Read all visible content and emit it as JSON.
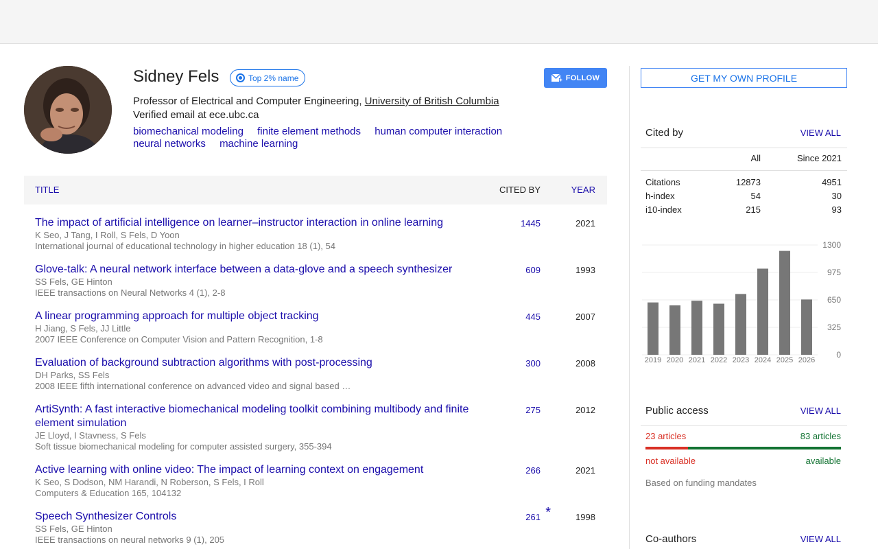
{
  "profile": {
    "name": "Sidney Fels",
    "badge": "Top 2% name",
    "follow": "FOLLOW",
    "title_prefix": "Professor of Electrical and Computer Engineering, ",
    "university": "University of British Columbia",
    "email": "Verified email at ece.ubc.ca",
    "interests": [
      "biomechanical modeling",
      "finite element methods",
      "human computer interaction",
      "neural networks",
      "machine learning"
    ]
  },
  "table": {
    "col_title": "TITLE",
    "col_cited": "CITED BY",
    "col_year": "YEAR",
    "rows": [
      {
        "title": "The impact of artificial intelligence on learner–instructor interaction in online learning",
        "authors": "K Seo, J Tang, I Roll, S Fels, D Yoon",
        "venue": "International journal of educational technology in higher education 18 (1), 54",
        "cites": "1445",
        "year": "2021",
        "star": ""
      },
      {
        "title": "Glove-talk: A neural network interface between a data-glove and a speech synthesizer",
        "authors": "SS Fels, GE Hinton",
        "venue": "IEEE transactions on Neural Networks 4 (1), 2-8",
        "cites": "609",
        "year": "1993",
        "star": ""
      },
      {
        "title": "A linear programming approach for multiple object tracking",
        "authors": "H Jiang, S Fels, JJ Little",
        "venue": "2007 IEEE Conference on Computer Vision and Pattern Recognition, 1-8",
        "cites": "445",
        "year": "2007",
        "star": ""
      },
      {
        "title": "Evaluation of background subtraction algorithms with post-processing",
        "authors": "DH Parks, SS Fels",
        "venue": "2008 IEEE fifth international conference on advanced video and signal based …",
        "cites": "300",
        "year": "2008",
        "star": ""
      },
      {
        "title": "ArtiSynth: A fast interactive biomechanical modeling toolkit combining multibody and finite element simulation",
        "authors": "JE Lloyd, I Stavness, S Fels",
        "venue": "Soft tissue biomechanical modeling for computer assisted surgery, 355-394",
        "cites": "275",
        "year": "2012",
        "star": ""
      },
      {
        "title": "Active learning with online video: The impact of learning context on engagement",
        "authors": "K Seo, S Dodson, NM Harandi, N Roberson, S Fels, I Roll",
        "venue": "Computers & Education 165, 104132",
        "cites": "266",
        "year": "2021",
        "star": ""
      },
      {
        "title": "Speech Synthesizer Controls",
        "authors": "SS Fels, GE Hinton",
        "venue": "IEEE transactions on neural networks 9 (1), 205",
        "cites": "261",
        "year": "1998",
        "star": "*"
      }
    ]
  },
  "sidebar": {
    "get_profile": "GET MY OWN PROFILE",
    "cited_by": "Cited by",
    "view_all": "VIEW ALL",
    "col_all": "All",
    "col_since": "Since 2021",
    "stats": [
      {
        "label": "Citations",
        "all": "12873",
        "since": "4951"
      },
      {
        "label": "h-index",
        "all": "54",
        "since": "30"
      },
      {
        "label": "i10-index",
        "all": "215",
        "since": "93"
      }
    ],
    "public_access": "Public access",
    "not_available_count": "23 articles",
    "available_count": "83 articles",
    "not_available": "not available",
    "available": "available",
    "funding_note": "Based on funding mandates",
    "coauthors": "Co-authors",
    "colors": {
      "not_available": "#d93025",
      "available": "#137333",
      "bar": "#777777"
    }
  },
  "chart_data": {
    "type": "bar",
    "categories": [
      "2019",
      "2020",
      "2021",
      "2022",
      "2023",
      "2024",
      "2025",
      "2026"
    ],
    "values": [
      620,
      585,
      640,
      605,
      720,
      1020,
      1230,
      655
    ],
    "ylim": [
      0,
      1300
    ],
    "yticks": [
      "1300",
      "975",
      "650",
      "325",
      "0"
    ],
    "title": "",
    "xlabel": "",
    "ylabel": ""
  }
}
